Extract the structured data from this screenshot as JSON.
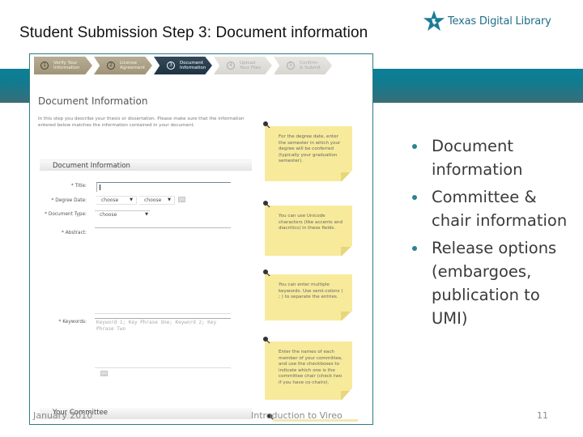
{
  "slide": {
    "title": "Student Submission Step 3: Document information",
    "logo_text": "Texas Digital Library",
    "bullets": [
      "Document information",
      "Committee & chair information",
      "Release options (embargoes, publication to UMI)"
    ],
    "footer": {
      "date": "January 2010",
      "center": "Introduction to Vireo",
      "page_number": "11"
    }
  },
  "screenshot": {
    "steps": [
      {
        "num": "1",
        "line1": "Verify Your",
        "line2": "Information",
        "state": "done"
      },
      {
        "num": "2",
        "line1": "License",
        "line2": "Agreement",
        "state": "done"
      },
      {
        "num": "3",
        "line1": "Document",
        "line2": "Information",
        "state": "active"
      },
      {
        "num": "4",
        "line1": "Upload",
        "line2": "Your Files",
        "state": "todo"
      },
      {
        "num": "5",
        "line1": "Confirm",
        "line2": "& Submit",
        "state": "todo"
      }
    ],
    "heading": "Document Information",
    "intro": "In this step you describe your thesis or dissertation. Please make sure that the information entered below matches the information contained in your document.",
    "section_title": "Document Information",
    "fields": {
      "title_label": "* Title:",
      "title_value": "",
      "degree_date_label": "* Degree Date:",
      "degree_month": "choose",
      "degree_year": "choose",
      "doc_type_label": "* Document Type:",
      "doc_type_value": "choose",
      "abstract_label": "* Abstract:",
      "keywords_label": "* Keywords:",
      "keywords_placeholder": "Keyword 1; Key Phrase One; Keyword 2; Key Phrase Two"
    },
    "notes": [
      "For the degree date, enter the semester in which your degree will be conferred (typically your graduation semester).",
      "You can use Unicode characters (like accents and diacritics) in these fields.",
      "You can enter multiple keywords. Use semi-colons ( ; ) to separate the entries.",
      "Enter the names of each member of your committee, and use the checkboxes to indicate which one is the committee chair (check two if you have co-chairs)."
    ],
    "committee_title": "Your Committee"
  },
  "colors": {
    "accent_teal": "#137a8e",
    "note_yellow": "#f7ea9b",
    "step_active": "#2a3f4e",
    "step_done": "#a99e84"
  }
}
